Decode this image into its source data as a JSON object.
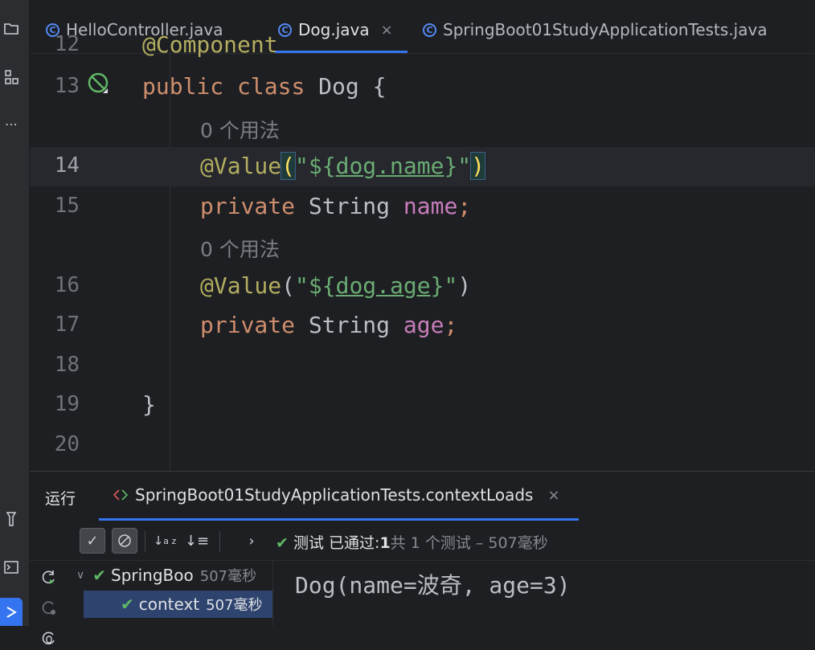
{
  "tabs": [
    {
      "label": "HelloController.java",
      "active": false
    },
    {
      "label": "Dog.java",
      "active": true,
      "closable": true
    },
    {
      "label": "SpringBoot01StudyApplicationTests.java",
      "active": false
    }
  ],
  "editor": {
    "partial_top": {
      "number": "12",
      "text": "@Component"
    },
    "lines": [
      {
        "number": "13",
        "parts": [
          [
            "kw",
            "public "
          ],
          [
            "kw",
            "class "
          ],
          [
            "",
            "Dog {"
          ]
        ]
      },
      {
        "hint": "0 个用法"
      },
      {
        "number": "14",
        "current": true
      },
      {
        "number": "15"
      },
      {
        "hint": "0 个用法"
      },
      {
        "number": "16"
      },
      {
        "number": "17"
      },
      {
        "number": "18"
      },
      {
        "number": "19"
      },
      {
        "number": "20"
      }
    ],
    "code": {
      "l13_public": "public",
      "l13_class": "class",
      "l13_rest": "Dog {",
      "hint1": "0 个用法",
      "l14_ann": "@Value",
      "l14_open": "(",
      "l14_q1": "\"${",
      "l14_key": "dog.name",
      "l14_q2": "}\"",
      "l14_close": ")",
      "l15_kw": "private",
      "l15_type": "String",
      "l15_name": "name",
      "l15_semi": ";",
      "hint2": "0 个用法",
      "l16_ann": "@Value",
      "l16_open": "(",
      "l16_q1": "\"${",
      "l16_key": "dog.age",
      "l16_q2": "}\"",
      "l16_close": ")",
      "l17_kw": "private",
      "l17_type": "String",
      "l17_name": "age",
      "l17_semi": ";",
      "l19": "}"
    }
  },
  "run": {
    "label": "运行",
    "tab_label": "SpringBoot01StudyApplicationTests.contextLoads",
    "status_prefix": "测试",
    "status_passed": "已通过:",
    "status_count": "1",
    "status_rest": "共 1 个测试 – 507毫秒",
    "tree": [
      {
        "label": "SpringBoo",
        "time": "507毫秒"
      },
      {
        "label": "context",
        "time": "507毫秒"
      }
    ],
    "console": "Dog(name=波奇, age=3)"
  },
  "colors": {
    "accent": "#3574f0",
    "keyword": "#cf8e6d",
    "annotation": "#b3ae60",
    "string": "#6aab73",
    "field": "#c77dbb",
    "pass": "#5fb865"
  }
}
